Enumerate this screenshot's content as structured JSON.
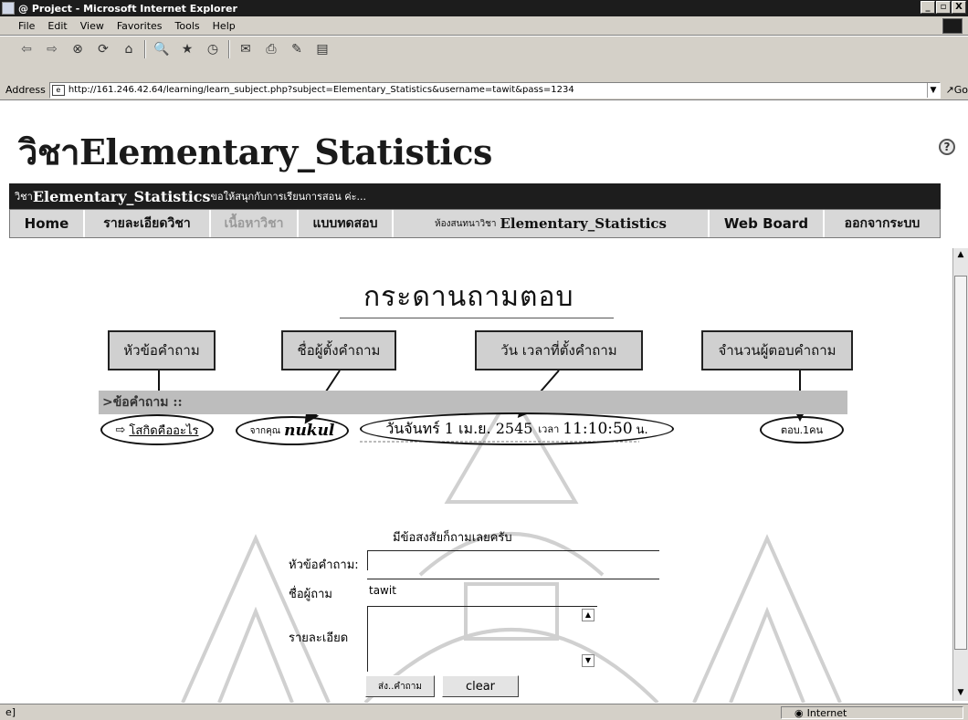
{
  "window": {
    "title": "@ Project - Microsoft Internet Explorer",
    "controls": [
      "_",
      "▫",
      "X"
    ]
  },
  "menu": [
    "File",
    "Edit",
    "View",
    "Favorites",
    "Tools",
    "Help"
  ],
  "toolbar": {
    "icons": [
      "back-icon",
      "forward-icon",
      "stop-icon",
      "refresh-icon",
      "home-icon",
      "search-icon",
      "favorites-icon",
      "history-icon",
      "mail-icon",
      "print-icon",
      "edit-icon",
      "discuss-icon"
    ]
  },
  "address": {
    "label": "Address",
    "url": "http://161.246.42.64/learning/learn_subject.php?subject=Elementary_Statistics&username=tawit&pass=1234",
    "go": "Go"
  },
  "page": {
    "title_prefix": "วิชา",
    "title_main": "Elementary_Statistics",
    "welcome_prefix": "วิชา",
    "welcome_main": "Elementary_Statistics",
    "welcome_suffix": "ขอให้สนุกกับการเรียนการสอน ค่ะ...",
    "nav": {
      "home": "Home",
      "details": "รายละเอียดวิชา",
      "content": "เนื้อหาวิชา",
      "quiz": "แบบทดสอบ",
      "chat_prefix": "ห้องสนทนาวิชา",
      "chat_main": "Elementary_Statistics",
      "webboard": "Web Board",
      "logout": "ออกจากระบบ"
    },
    "board_heading": "กระดานถามตอบ",
    "callouts": {
      "topic": "หัวข้อคำถาม",
      "asker": "ชื่อผู้ตั้งคำถาม",
      "datetime": "วัน เวลาที่ตั้งคำถาม",
      "replies": "จำนวนผู้ตอบคำถาม"
    },
    "q_header": ">ข้อคำถาม ::",
    "question": {
      "topic": "โสกิดคืออะไร",
      "from_prefix": "จากคุณ",
      "from_name": "nukul",
      "date": "วันจันทร์ 1 เม.ย. 2545",
      "time_prefix": "เวลา",
      "time": "11:10:50",
      "time_suffix": "น.",
      "replies": "ตอบ.1คน"
    },
    "form": {
      "prompt": "มีข้อสงสัยก็ถามเลยครับ",
      "topic_label": "หัวข้อคำถาม:",
      "topic_value": "",
      "name_label": "ชื่อผู้ถาม",
      "name_value": "tawit",
      "detail_label": "รายละเอียด",
      "submit": "ส่ง..คำถาม",
      "clear": "clear"
    }
  },
  "status": {
    "zone": "Internet"
  }
}
